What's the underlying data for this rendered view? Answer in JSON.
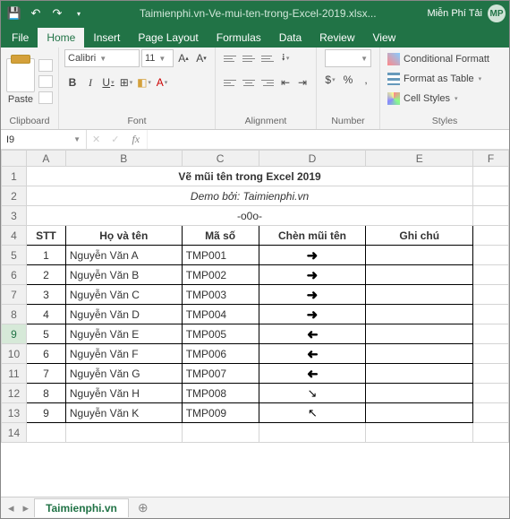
{
  "title_file": "Taimienphi.vn-Ve-mui-ten-trong-Excel-2019.xlsx...",
  "user_name": "Miễn Phí Tải",
  "user_initials": "MP",
  "tabs": {
    "file": "File",
    "home": "Home",
    "insert": "Insert",
    "page": "Page Layout",
    "formulas": "Formulas",
    "data": "Data",
    "review": "Review",
    "view": "View"
  },
  "ribbon": {
    "paste": "Paste",
    "clipboard": "Clipboard",
    "font_name": "Calibri",
    "font_size": "11",
    "font": "Font",
    "alignment": "Alignment",
    "number": "Number",
    "number_fmt": "",
    "styles": "Styles",
    "cond": "Conditional Formatt",
    "table": "Format as Table",
    "cell": "Cell Styles"
  },
  "namebox": "I9",
  "fx": "fx",
  "cols": [
    "A",
    "B",
    "C",
    "D",
    "E",
    "F"
  ],
  "sheet": {
    "title": "Vẽ mũi tên trong Excel 2019",
    "demo": "Demo bởi: Taimienphi.vn",
    "o0o": "-o0o-",
    "headers": {
      "stt": "STT",
      "name": "Họ và tên",
      "code": "Mã số",
      "arrow": "Chèn mũi tên",
      "note": "Ghi chú"
    },
    "rows": [
      {
        "stt": "1",
        "name": "Nguyễn Văn A",
        "code": "TMP001",
        "arr": "R"
      },
      {
        "stt": "2",
        "name": "Nguyễn Văn B",
        "code": "TMP002",
        "arr": "R"
      },
      {
        "stt": "3",
        "name": "Nguyễn Văn C",
        "code": "TMP003",
        "arr": "R"
      },
      {
        "stt": "4",
        "name": "Nguyễn Văn D",
        "code": "TMP004",
        "arr": "R"
      },
      {
        "stt": "5",
        "name": "Nguyễn Văn E",
        "code": "TMP005",
        "arr": "L"
      },
      {
        "stt": "6",
        "name": "Nguyễn Văn F",
        "code": "TMP006",
        "arr": "L"
      },
      {
        "stt": "7",
        "name": "Nguyễn Văn G",
        "code": "TMP007",
        "arr": "L"
      },
      {
        "stt": "8",
        "name": "Nguyễn Văn H",
        "code": "TMP008",
        "arr": "D"
      },
      {
        "stt": "9",
        "name": "Nguyễn Văn K",
        "code": "TMP009",
        "arr": "U"
      }
    ]
  },
  "ws_tab": "Taimienphi.vn"
}
